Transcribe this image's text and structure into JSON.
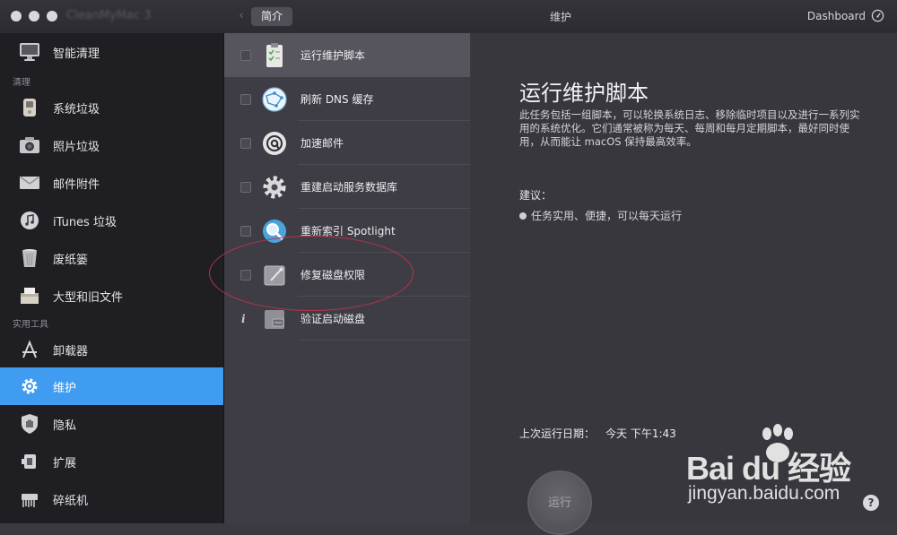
{
  "window": {
    "app_name": "CleanMyMac 3",
    "title": "维护",
    "tab_intro": "简介",
    "dashboard_label": "Dashboard"
  },
  "sidebar": {
    "items": [
      {
        "label": "智能清理",
        "icon": "monitor-icon"
      },
      {
        "label": "系统垃圾",
        "icon": "trash-mac-icon"
      },
      {
        "label": "照片垃圾",
        "icon": "camera-icon"
      },
      {
        "label": "邮件附件",
        "icon": "mail-icon"
      },
      {
        "label": "iTunes 垃圾",
        "icon": "music-note-icon"
      },
      {
        "label": "废纸篓",
        "icon": "trash-bin-icon"
      },
      {
        "label": "大型和旧文件",
        "icon": "box-icon"
      },
      {
        "label": "卸载器",
        "icon": "app-store-icon"
      },
      {
        "label": "维护",
        "icon": "gear-icon"
      },
      {
        "label": "隐私",
        "icon": "hand-shield-icon"
      },
      {
        "label": "扩展",
        "icon": "plugin-icon"
      },
      {
        "label": "碎纸机",
        "icon": "shredder-icon"
      }
    ],
    "sections": {
      "clean": "清理",
      "utilities": "实用工具"
    }
  },
  "tasks": [
    {
      "label": "运行维护脚本",
      "icon": "clipboard-check-icon",
      "marker": "checkbox"
    },
    {
      "label": "刷新 DNS 缓存",
      "icon": "network-globe-icon",
      "marker": "checkbox"
    },
    {
      "label": "加速邮件",
      "icon": "at-sign-icon",
      "marker": "checkbox"
    },
    {
      "label": "重建启动服务数据库",
      "icon": "gear-icon",
      "marker": "checkbox"
    },
    {
      "label": "重新索引 Spotlight",
      "icon": "magnifier-icon",
      "marker": "checkbox"
    },
    {
      "label": "修复磁盘权限",
      "icon": "disk-repair-icon",
      "marker": "checkbox"
    },
    {
      "label": "验证启动磁盘",
      "icon": "disk-check-icon",
      "marker": "info"
    }
  ],
  "detail": {
    "title": "运行维护脚本",
    "description": "此任务包括一组脚本，可以轮换系统日志、移除临时项目以及进行一系列实用的系统优化。它们通常被称为每天、每周和每月定期脚本，最好同时使用，从而能让 macOS 保持最高效率。",
    "advice_label": "建议：",
    "advice_item": "任务实用、便捷，可以每天运行",
    "last_run_label": "上次运行日期：",
    "last_run_value": "今天 下午1:43",
    "run_button": "运行",
    "help": "?"
  },
  "watermark": {
    "main": "Bai du 经验",
    "sub": "jingyan.baidu.com"
  },
  "colors": {
    "accent": "#3f9cf1",
    "annotation": "#b8334a"
  }
}
